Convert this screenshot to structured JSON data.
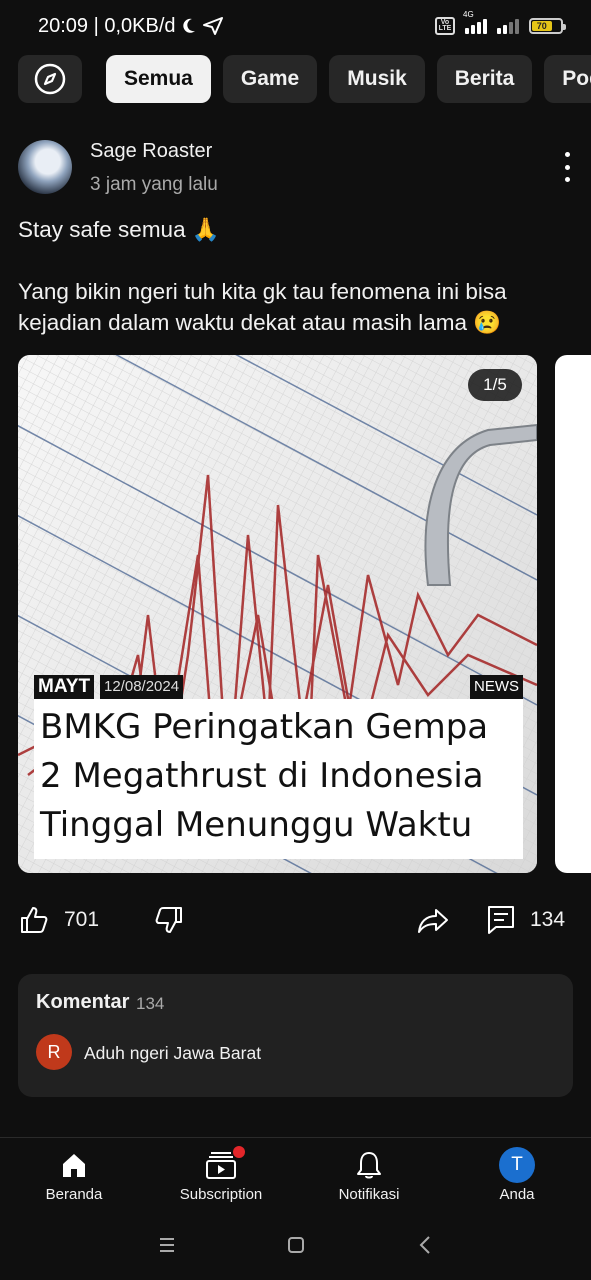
{
  "status_bar": {
    "time_speed": "20:09 | 0,0KB/d",
    "network": "4G",
    "volte": "Vo LTE",
    "battery": "70"
  },
  "chips": [
    {
      "label": "Semua",
      "active": true
    },
    {
      "label": "Game"
    },
    {
      "label": "Musik"
    },
    {
      "label": "Berita"
    },
    {
      "label": "Podcast"
    }
  ],
  "post": {
    "author": "Sage Roaster",
    "time": "3 jam yang lalu",
    "text": "Stay safe semua 🙏\n\nYang bikin ngeri tuh kita gk tau fenomena ini bisa kejadian dalam waktu dekat atau masih lama 😢",
    "image": {
      "counter": "1/5",
      "source": "MAYT",
      "date": "12/08/2024",
      "category": "NEWS",
      "headline": "BMKG Peringatkan Gempa\n2 Megathrust di Indonesia\nTinggal Menunggu Waktu"
    },
    "likes": "701",
    "comments": "134"
  },
  "comments_section": {
    "title": "Komentar",
    "count": "134",
    "top_comment": {
      "initial": "R",
      "text": "Aduh ngeri Jawa Barat"
    }
  },
  "bottom_nav": [
    {
      "label": "Beranda"
    },
    {
      "label": "Subscription"
    },
    {
      "label": "Notifikasi"
    },
    {
      "label": "Anda",
      "initial": "T"
    }
  ],
  "colors": {
    "background": "#0f0f0f",
    "chip": "#272727",
    "card": "#212121",
    "badge": "#e3262a",
    "comment_avatar": "#c0391b",
    "profile": "#1b6fcf"
  }
}
